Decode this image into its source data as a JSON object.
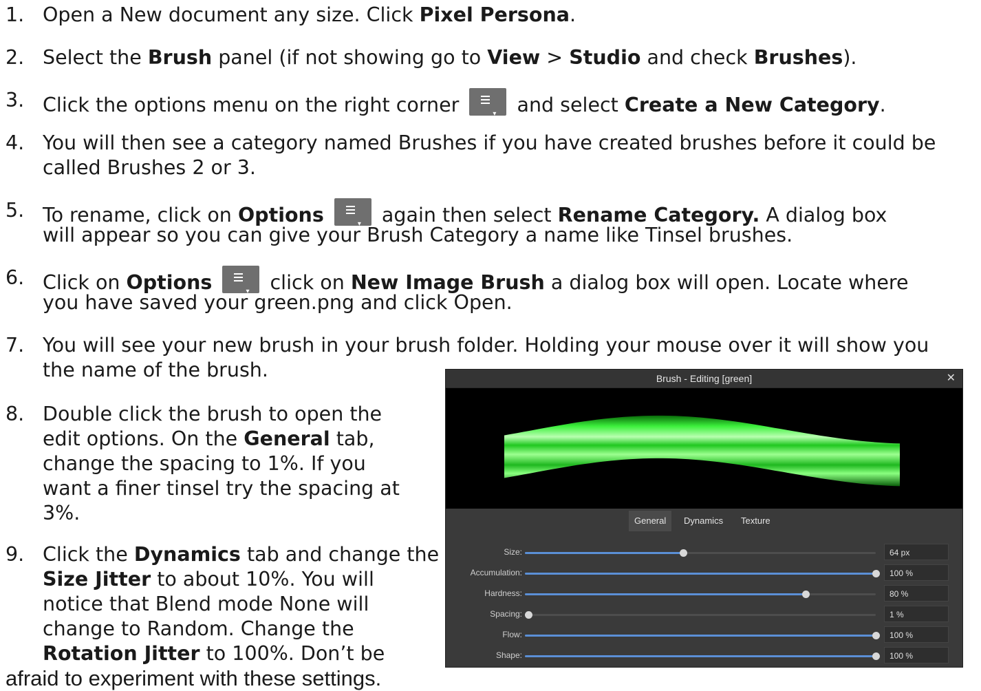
{
  "steps": [
    {
      "num": "1.",
      "parts": [
        {
          "t": "Open a New document  any size. Click "
        },
        {
          "b": "Pixel Persona"
        },
        {
          "t": "."
        }
      ]
    },
    {
      "num": "2.",
      "parts": [
        {
          "t": "Select the "
        },
        {
          "b": "Brush"
        },
        {
          "t": " panel (if not showing go to "
        },
        {
          "b": "View"
        },
        {
          "t": " > "
        },
        {
          "b": "Studio"
        },
        {
          "t": " and check "
        },
        {
          "b": "Brushes"
        },
        {
          "t": ")."
        }
      ]
    },
    {
      "num": "3.",
      "parts": [
        {
          "t": "Click the options menu on the right corner "
        },
        {
          "icon": "options-menu-icon"
        },
        {
          "t": " and select  "
        },
        {
          "b": "Create a New Category"
        },
        {
          "t": "."
        }
      ]
    },
    {
      "num": "4.",
      "parts": [
        {
          "t": "You will then see a category named Brushes if you have created brushes before it could be"
        }
      ],
      "line2": "called Brushes 2 or 3."
    },
    {
      "num": "5.",
      "parts": [
        {
          "t": "To rename, click on "
        },
        {
          "b": "Options"
        },
        {
          "t": " "
        },
        {
          "icon": "options-menu-icon"
        },
        {
          "t": " again then select  "
        },
        {
          "b": "Rename Category."
        },
        {
          "t": "  A dialog box"
        }
      ],
      "line2": "will appear so you can give your Brush Category a name like Tinsel brushes."
    },
    {
      "num": "6.",
      "parts": [
        {
          "t": "Click on "
        },
        {
          "b": "Options"
        },
        {
          "t": " "
        },
        {
          "icon": "options-menu-icon"
        },
        {
          "t": " click on "
        },
        {
          "b": "New  Image Brush"
        },
        {
          "t": " a dialog box will open.  Locate where"
        }
      ],
      "line2": "you have saved your green.png and click Open."
    },
    {
      "num": "7.",
      "parts": [
        {
          "t": "You will see your new brush in your brush folder.  Holding your mouse over it will show you"
        }
      ],
      "line2": "the name of the brush."
    }
  ],
  "step8": {
    "num": "8.",
    "lines": [
      [
        {
          "t": "Double click the brush to open the"
        }
      ],
      [
        {
          "t": "edit options.  On the "
        },
        {
          "b": "General"
        },
        {
          "t": " tab,"
        }
      ],
      [
        {
          "t": "change the spacing to 1%.  If you"
        }
      ],
      [
        {
          "t": "want a finer tinsel try the spacing at"
        }
      ],
      [
        {
          "t": "3%."
        }
      ]
    ]
  },
  "step9": {
    "num": "9.",
    "lines": [
      [
        {
          "t": "Click the "
        },
        {
          "b": "Dynamics"
        },
        {
          "t": " tab and change the"
        }
      ],
      [
        {
          "b": "Size Jitter"
        },
        {
          "t": " to about 10%.  You will"
        }
      ],
      [
        {
          "t": "notice that Blend mode None will"
        }
      ],
      [
        {
          "t": "change  to  Random.  Change  the"
        }
      ],
      [
        {
          "b": "Rotation Jitter"
        },
        {
          "t": " to 100%. Don’t be"
        }
      ]
    ],
    "tail": "afraid to experiment with these settings."
  },
  "dialog": {
    "title": "Brush - Editing [green]",
    "close": "✕",
    "tabs": [
      {
        "label": "General",
        "active": true
      },
      {
        "label": "Dynamics",
        "active": false
      },
      {
        "label": "Texture",
        "active": false
      }
    ],
    "stroke_color": "#22dd22",
    "sliders": [
      {
        "label": "Size:",
        "value": "64 px",
        "level": 0.45
      },
      {
        "label": "Accumulation:",
        "value": "100 %",
        "level": 1.0
      },
      {
        "label": "Hardness:",
        "value": "80 %",
        "level": 0.8
      },
      {
        "label": "Spacing:",
        "value": "1 %",
        "level": 0.01
      },
      {
        "label": "Flow:",
        "value": "100 %",
        "level": 1.0
      },
      {
        "label": "Shape:",
        "value": "100 %",
        "level": 1.0
      }
    ]
  }
}
